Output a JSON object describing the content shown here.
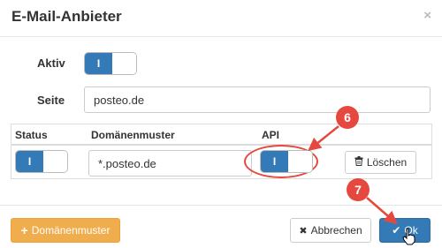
{
  "dialog": {
    "title": "E-Mail-Anbieter",
    "close_icon": "×"
  },
  "form": {
    "active_label": "Aktiv",
    "active_toggle_on": "I",
    "site_label": "Seite",
    "site_value": "posteo.de"
  },
  "table": {
    "headers": {
      "status": "Status",
      "pattern": "Domänenmuster",
      "api": "API"
    },
    "row": {
      "status_toggle_on": "I",
      "pattern_value": "*.posteo.de",
      "api_toggle_on": "I",
      "delete_label": "Löschen",
      "delete_icon": "trash-icon"
    }
  },
  "footer": {
    "add_pattern_label": "Domänenmuster",
    "add_icon": "+",
    "cancel_label": "Abbrechen",
    "cancel_icon": "✖",
    "ok_label": "Ok",
    "ok_icon": "✔"
  },
  "annotations": {
    "callout_6": "6",
    "callout_7": "7"
  },
  "colors": {
    "primary": "#337ab7",
    "warning": "#f0ad4e",
    "callout": "#e4483e"
  }
}
